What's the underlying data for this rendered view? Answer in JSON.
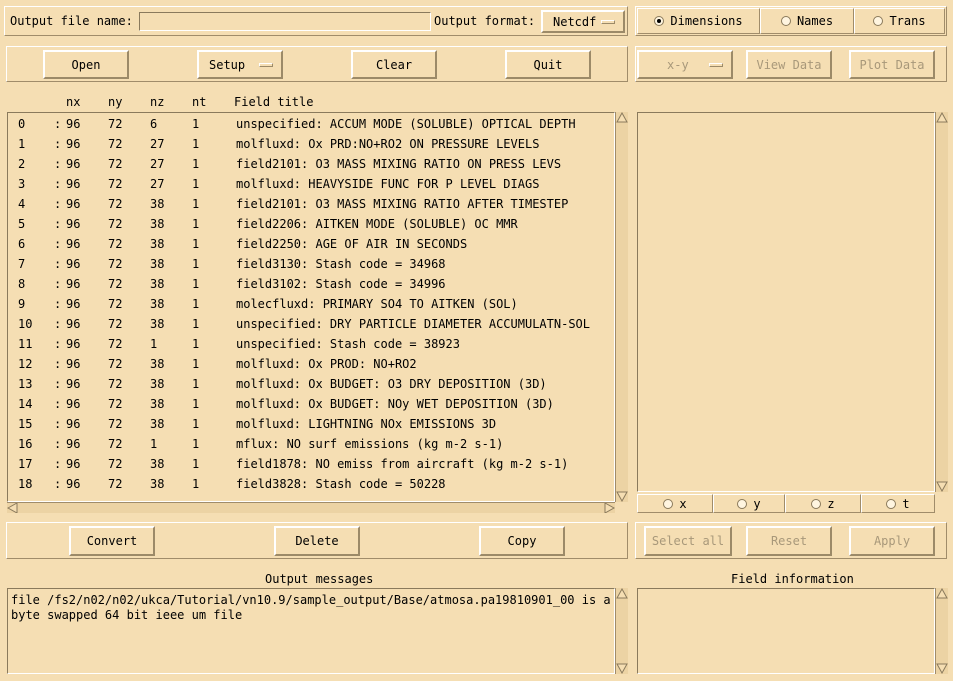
{
  "top": {
    "output_file_label": "Output file name:",
    "output_file_value": "",
    "output_format_label": "Output format:",
    "output_format_value": "Netcdf"
  },
  "mode_radios": [
    {
      "label": "Dimensions",
      "selected": true
    },
    {
      "label": "Names",
      "selected": false
    },
    {
      "label": "Trans",
      "selected": false
    }
  ],
  "toolbar": {
    "open": "Open",
    "setup": "Setup",
    "clear": "Clear",
    "quit": "Quit"
  },
  "plot_toolbar": {
    "axes": "x-y",
    "view_data": "View Data",
    "plot_data": "Plot Data"
  },
  "table": {
    "headers": {
      "nx": "nx",
      "ny": "ny",
      "nz": "nz",
      "nt": "nt",
      "title": "Field title"
    },
    "rows": [
      {
        "idx": "0",
        "nx": "96",
        "ny": "72",
        "nz": "6",
        "nt": "1",
        "title": "unspecified: ACCUM MODE (SOLUBLE) OPTICAL DEPTH"
      },
      {
        "idx": "1",
        "nx": "96",
        "ny": "72",
        "nz": "27",
        "nt": "1",
        "title": "molfluxd: Ox PRD:NO+RO2 ON PRESSURE LEVELS"
      },
      {
        "idx": "2",
        "nx": "96",
        "ny": "72",
        "nz": "27",
        "nt": "1",
        "title": "field2101: O3 MASS MIXING RATIO ON PRESS LEVS"
      },
      {
        "idx": "3",
        "nx": "96",
        "ny": "72",
        "nz": "27",
        "nt": "1",
        "title": "molfluxd: HEAVYSIDE FUNC FOR P LEVEL DIAGS"
      },
      {
        "idx": "4",
        "nx": "96",
        "ny": "72",
        "nz": "38",
        "nt": "1",
        "title": "field2101: O3 MASS MIXING RATIO AFTER TIMESTEP"
      },
      {
        "idx": "5",
        "nx": "96",
        "ny": "72",
        "nz": "38",
        "nt": "1",
        "title": "field2206: AITKEN MODE (SOLUBLE) OC MMR"
      },
      {
        "idx": "6",
        "nx": "96",
        "ny": "72",
        "nz": "38",
        "nt": "1",
        "title": "field2250: AGE OF AIR IN SECONDS"
      },
      {
        "idx": "7",
        "nx": "96",
        "ny": "72",
        "nz": "38",
        "nt": "1",
        "title": "field3130: Stash code = 34968"
      },
      {
        "idx": "8",
        "nx": "96",
        "ny": "72",
        "nz": "38",
        "nt": "1",
        "title": "field3102: Stash code = 34996"
      },
      {
        "idx": "9",
        "nx": "96",
        "ny": "72",
        "nz": "38",
        "nt": "1",
        "title": "molecfluxd: PRIMARY SO4 TO AITKEN (SOL)"
      },
      {
        "idx": "10",
        "nx": "96",
        "ny": "72",
        "nz": "38",
        "nt": "1",
        "title": "unspecified: DRY PARTICLE DIAMETER ACCUMULATN-SOL"
      },
      {
        "idx": "11",
        "nx": "96",
        "ny": "72",
        "nz": "1",
        "nt": "1",
        "title": "unspecified: Stash code = 38923"
      },
      {
        "idx": "12",
        "nx": "96",
        "ny": "72",
        "nz": "38",
        "nt": "1",
        "title": "molfluxd: Ox PROD: NO+RO2"
      },
      {
        "idx": "13",
        "nx": "96",
        "ny": "72",
        "nz": "38",
        "nt": "1",
        "title": "molfluxd: Ox BUDGET: O3 DRY DEPOSITION (3D)"
      },
      {
        "idx": "14",
        "nx": "96",
        "ny": "72",
        "nz": "38",
        "nt": "1",
        "title": "molfluxd: Ox BUDGET: NOy WET DEPOSITION (3D)"
      },
      {
        "idx": "15",
        "nx": "96",
        "ny": "72",
        "nz": "38",
        "nt": "1",
        "title": "molfluxd: LIGHTNING NOx EMISSIONS 3D"
      },
      {
        "idx": "16",
        "nx": "96",
        "ny": "72",
        "nz": "1",
        "nt": "1",
        "title": "mflux: NO surf emissions (kg m-2 s-1)"
      },
      {
        "idx": "17",
        "nx": "96",
        "ny": "72",
        "nz": "38",
        "nt": "1",
        "title": "field1878: NO emiss from aircraft (kg m-2 s-1)"
      },
      {
        "idx": "18",
        "nx": "96",
        "ny": "72",
        "nz": "38",
        "nt": "1",
        "title": "field3828: Stash code = 50228"
      }
    ]
  },
  "dim_radios": [
    {
      "label": "x"
    },
    {
      "label": "y"
    },
    {
      "label": "z"
    },
    {
      "label": "t"
    }
  ],
  "actions": {
    "convert": "Convert",
    "delete": "Delete",
    "copy": "Copy"
  },
  "selection_actions": {
    "select_all": "Select all",
    "reset": "Reset",
    "apply": "Apply"
  },
  "output_messages": {
    "title": "Output messages",
    "line1": "file /fs2/n02/n02/ukca/Tutorial/vn10.9/sample_output/Base/atmosa.pa19810901_00 is a",
    "line2": "byte swapped 64 bit ieee um file"
  },
  "field_info": {
    "title": "Field information"
  }
}
